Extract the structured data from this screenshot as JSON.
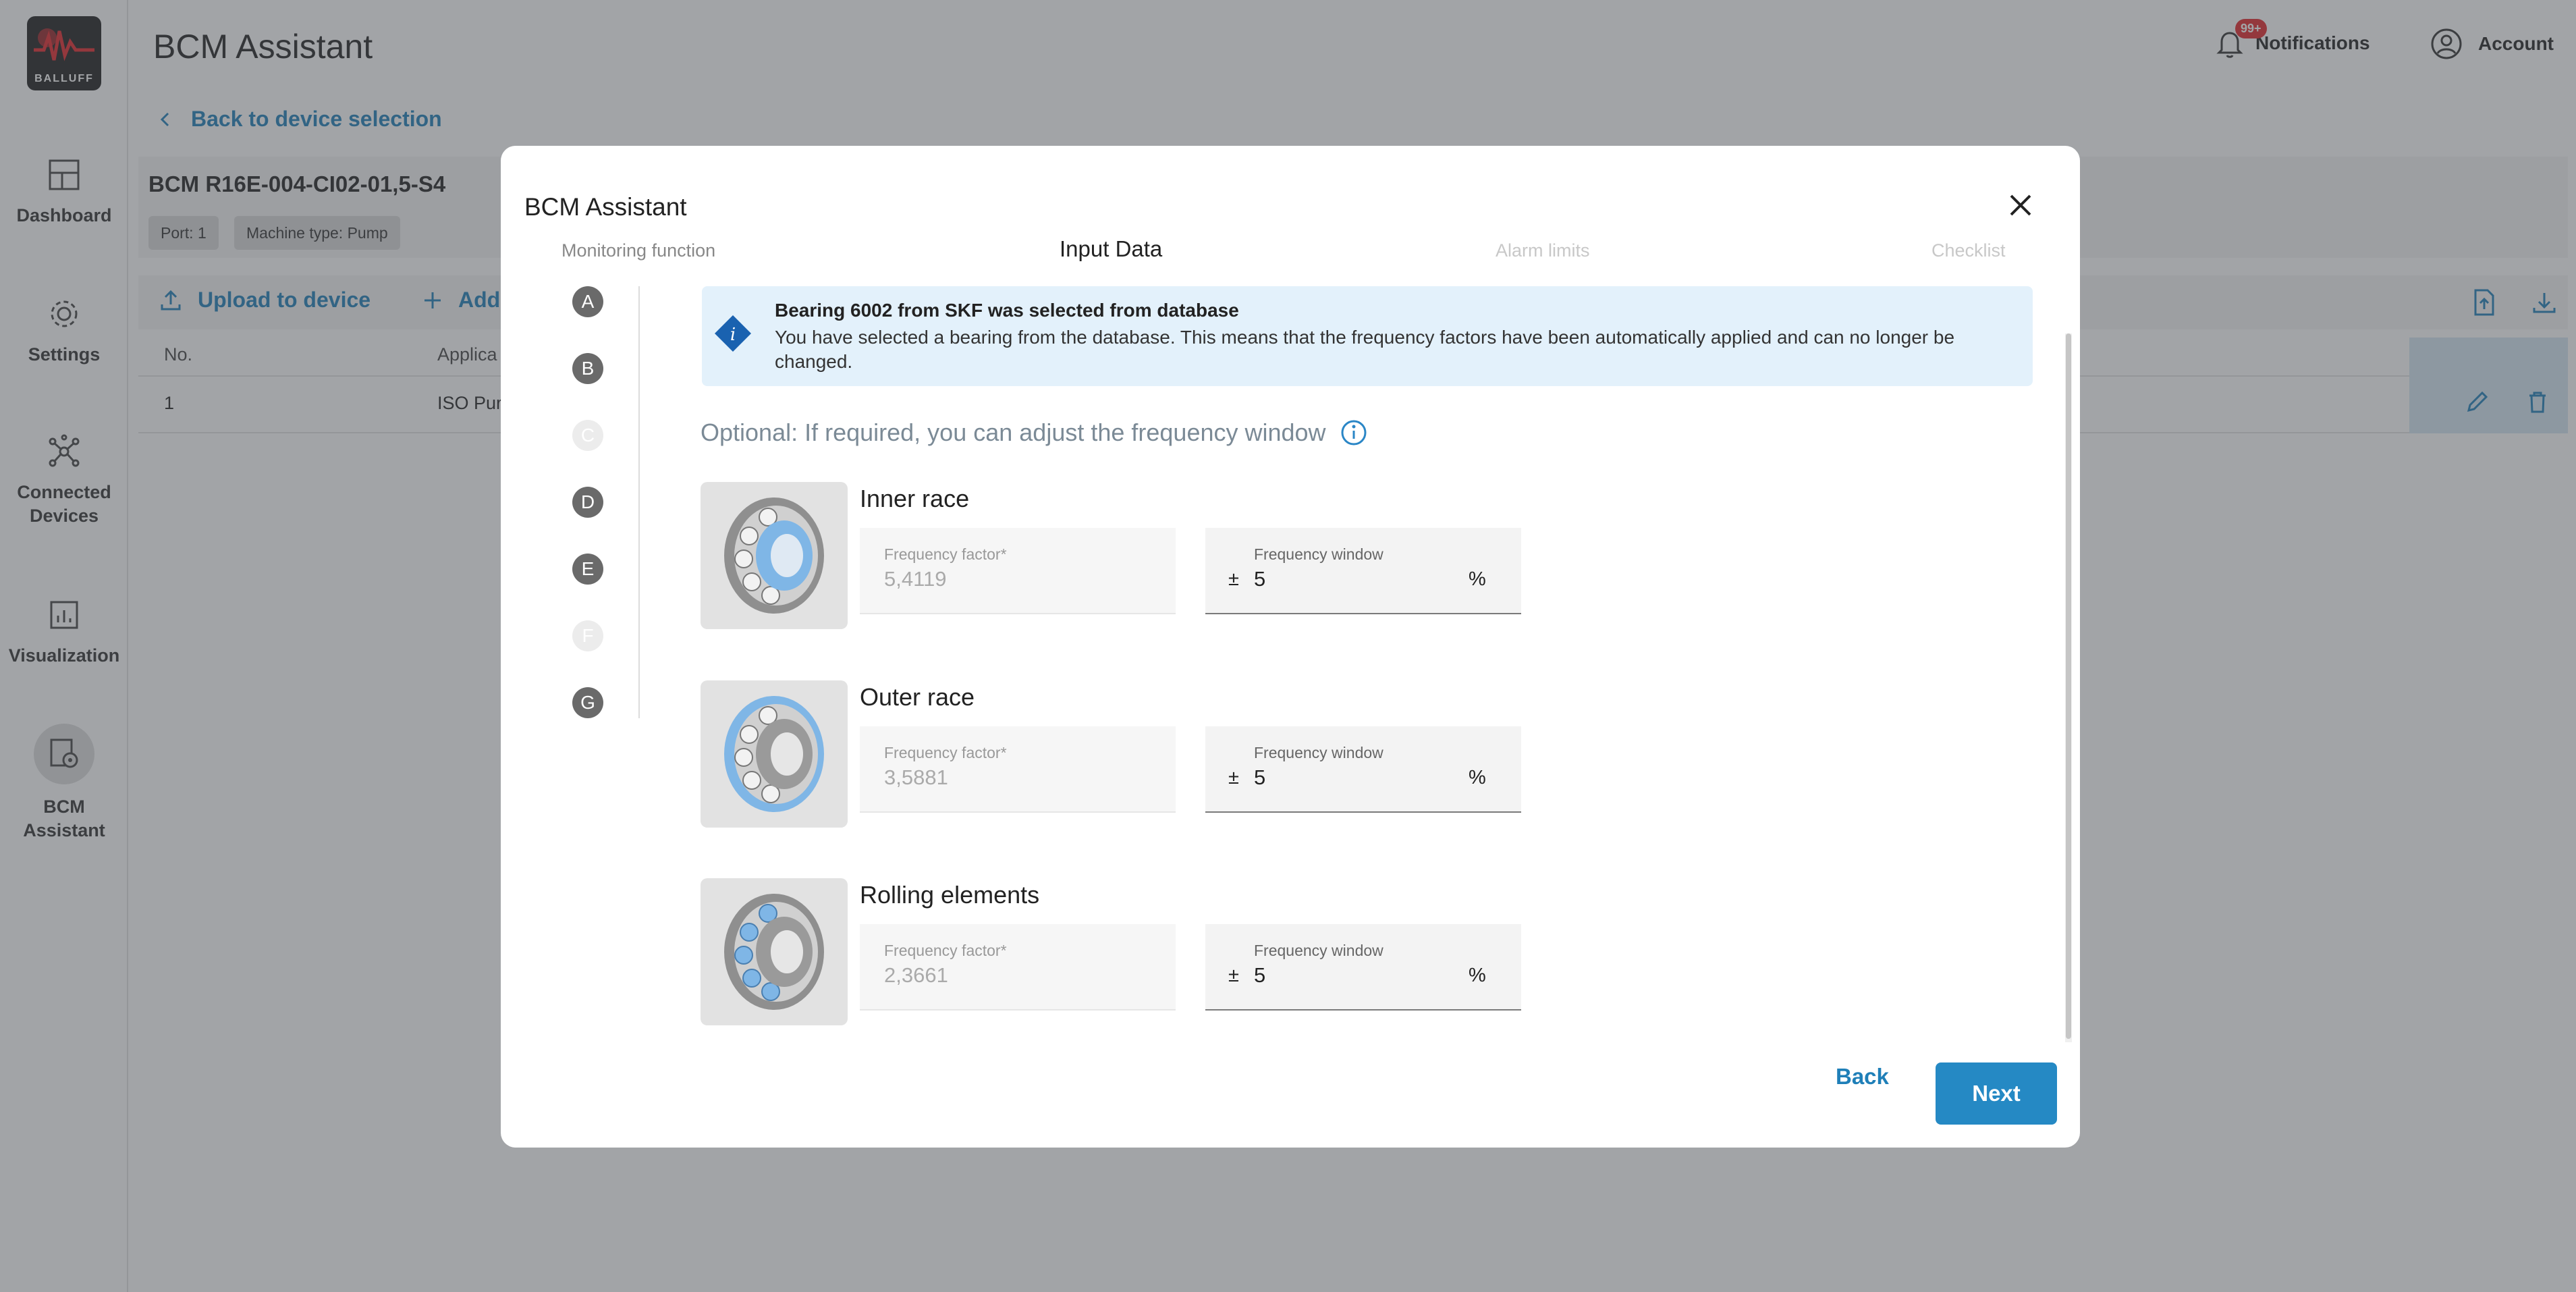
{
  "app": {
    "title": "BCM Assistant",
    "logo_text": "BALLUFF",
    "notifications_label": "Notifications",
    "notifications_badge": "99+",
    "account_label": "Account"
  },
  "sidebar": {
    "items": [
      {
        "label": "Dashboard",
        "icon": "dashboard-icon"
      },
      {
        "label": "Settings",
        "icon": "gear-icon"
      },
      {
        "label": "Connected",
        "label2": "Devices",
        "icon": "network-icon"
      },
      {
        "label": "Visualization",
        "icon": "chart-icon"
      },
      {
        "label": "BCM",
        "label2": "Assistant",
        "icon": "assistant-icon",
        "active": true
      }
    ]
  },
  "page": {
    "back_link": "Back to device selection",
    "device_name": "BCM R16E-004-CI02-01,5-S4",
    "chips": [
      "Port: 1",
      "Machine type: Pump"
    ],
    "toolbar": {
      "upload": "Upload to device",
      "add": "Add"
    },
    "table": {
      "headers": [
        "No.",
        "Applica"
      ],
      "rows": [
        [
          "1",
          "ISO Pur"
        ]
      ]
    }
  },
  "modal": {
    "title": "BCM Assistant",
    "steps": [
      {
        "label": "Monitoring function",
        "state": "done"
      },
      {
        "label": "Input Data",
        "state": "current"
      },
      {
        "label": "Alarm limits",
        "state": "upcoming"
      },
      {
        "label": "Checklist",
        "state": "upcoming"
      }
    ],
    "sub_steps": [
      {
        "letter": "A",
        "enabled": true
      },
      {
        "letter": "B",
        "enabled": true
      },
      {
        "letter": "C",
        "enabled": false
      },
      {
        "letter": "D",
        "enabled": true
      },
      {
        "letter": "E",
        "enabled": true
      },
      {
        "letter": "F",
        "enabled": false
      },
      {
        "letter": "G",
        "enabled": true
      }
    ],
    "info": {
      "title": "Bearing 6002 from SKF was selected from database",
      "text": "You have selected a bearing from the database. This means that the frequency factors have been automatically applied and can no longer be changed."
    },
    "optional_text": "Optional: If required, you can adjust the frequency window",
    "rows": [
      {
        "title": "Inner race",
        "factor_label": "Frequency factor*",
        "factor_value": "5,4119",
        "window_label": "Frequency window",
        "window_prefix": "±",
        "window_value": "5",
        "window_unit": "%"
      },
      {
        "title": "Outer race",
        "factor_label": "Frequency factor*",
        "factor_value": "3,5881",
        "window_label": "Frequency window",
        "window_prefix": "±",
        "window_value": "5",
        "window_unit": "%"
      },
      {
        "title": "Rolling elements",
        "factor_label": "Frequency factor*",
        "factor_value": "2,3661",
        "window_label": "Frequency window",
        "window_prefix": "±",
        "window_value": "5",
        "window_unit": "%"
      }
    ],
    "buttons": {
      "back": "Back",
      "next": "Next"
    }
  },
  "colors": {
    "accent": "#2589c4",
    "link": "#1f7fb8",
    "info_bg": "#e3f1fb",
    "info_icon": "#1a62b0",
    "highlight_part": "#7fb6e6"
  }
}
